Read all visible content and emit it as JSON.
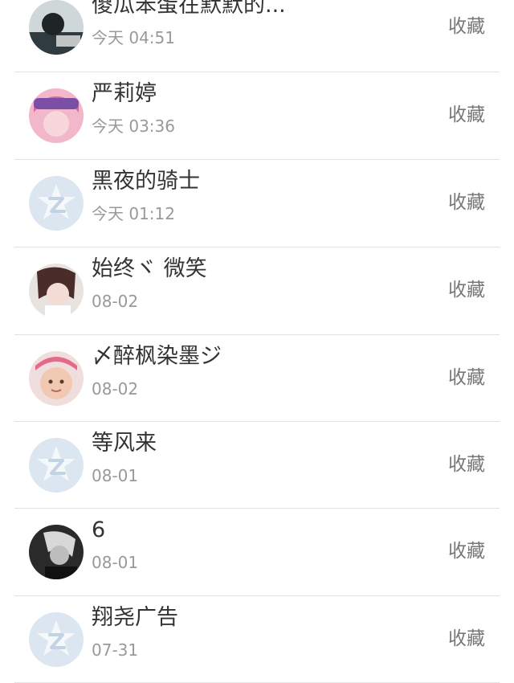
{
  "items": [
    {
      "name": "傻瓜笨蛋在默默的...",
      "time": "今天 04:51",
      "action": "收藏",
      "avatar": "photo-dark"
    },
    {
      "name": "严莉婷",
      "time": "今天 03:36",
      "action": "收藏",
      "avatar": "photo-pink"
    },
    {
      "name": "黑夜的骑士",
      "time": "今天 01:12",
      "action": "收藏",
      "avatar": "default-qzone"
    },
    {
      "name": "始终ヾ 微笑",
      "time": "08-02",
      "action": "收藏",
      "avatar": "photo-girl"
    },
    {
      "name": "〆醉枫染墨ジ",
      "time": "08-02",
      "action": "收藏",
      "avatar": "photo-child"
    },
    {
      "name": "等风来",
      "time": "08-01",
      "action": "收藏",
      "avatar": "default-qzone"
    },
    {
      "name": "6",
      "time": "08-01",
      "action": "收藏",
      "avatar": "photo-bw"
    },
    {
      "name": "翔尧广告",
      "time": "07-31",
      "action": "收藏",
      "avatar": "default-qzone"
    }
  ],
  "colors": {
    "name": "#333333",
    "time": "#999999",
    "action": "#777777",
    "divider": "#e2e2e2",
    "default_avatar": "#dbe6f0"
  }
}
